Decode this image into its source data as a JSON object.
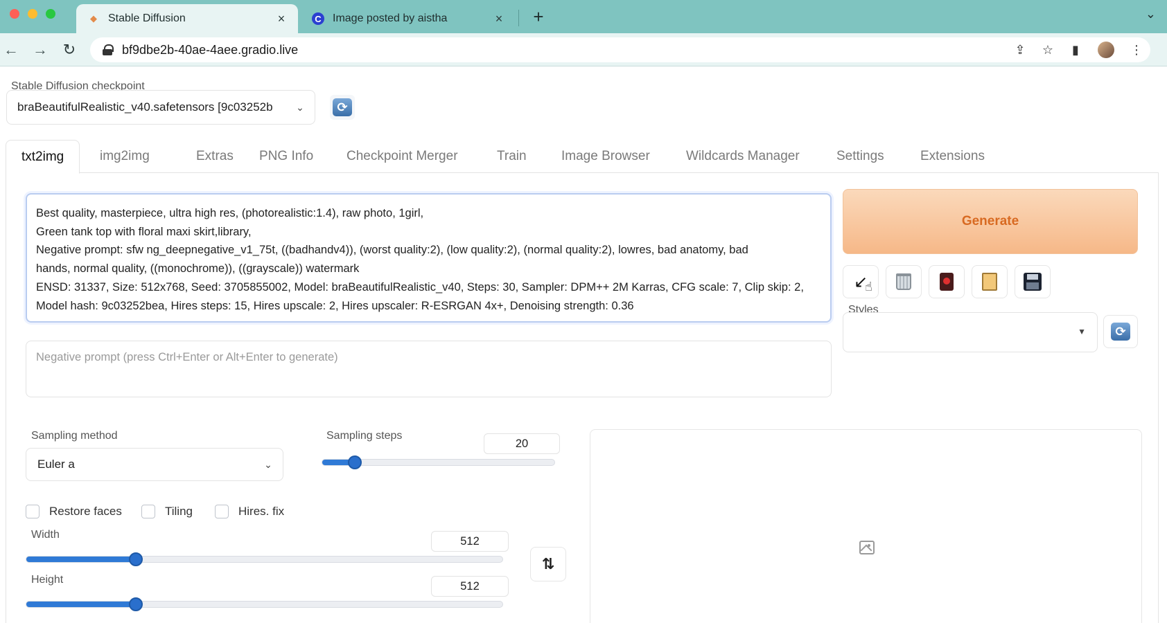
{
  "browser": {
    "tabs": [
      {
        "title": "Stable Diffusion",
        "active": true
      },
      {
        "title": "Image posted by aistha",
        "active": false
      }
    ],
    "url": "bf9dbe2b-40ae-4aee.gradio.live"
  },
  "checkpoint": {
    "label": "Stable Diffusion checkpoint",
    "value": "braBeautifulRealistic_v40.safetensors [9c03252b"
  },
  "tabs": [
    {
      "label": "txt2img",
      "active": true
    },
    {
      "label": "img2img"
    },
    {
      "label": "Extras"
    },
    {
      "label": "PNG Info"
    },
    {
      "label": "Checkpoint Merger"
    },
    {
      "label": "Train"
    },
    {
      "label": "Image Browser"
    },
    {
      "label": "Wildcards Manager"
    },
    {
      "label": "Settings"
    },
    {
      "label": "Extensions"
    }
  ],
  "prompt": {
    "lines": [
      "Best quality, masterpiece, ultra high res, (photorealistic:1.4), raw photo, 1girl,",
      "Green tank top with floral maxi skirt,library,",
      "Negative prompt: sfw ng_deepnegative_v1_75t, ((badhandv4)), (worst quality:2), (low quality:2), (normal quality:2), lowres, bad anatomy, bad",
      "hands, normal quality, ((monochrome)), ((grayscale)) watermark",
      "ENSD: 31337, Size: 512x768, Seed: 3705855002, Model: braBeautifulRealistic_v40, Steps: 30, Sampler: DPM++ 2M Karras, CFG scale: 7, Clip skip: 2,",
      "Model hash: 9c03252bea, Hires steps: 15, Hires upscale: 2, Hires upscaler: R-ESRGAN 4x+, Denoising strength: 0.36"
    ],
    "negative_placeholder": "Negative prompt (press Ctrl+Enter or Alt+Enter to generate)"
  },
  "generate_label": "Generate",
  "styles_label": "Styles",
  "sampling": {
    "method_label": "Sampling method",
    "method_value": "Euler a",
    "steps_label": "Sampling steps",
    "steps_value": "20",
    "steps_fraction": 0.14
  },
  "checkboxes": {
    "restore_faces": "Restore faces",
    "tiling": "Tiling",
    "hires_fix": "Hires. fix"
  },
  "width": {
    "label": "Width",
    "value": "512",
    "fraction": 0.23
  },
  "height": {
    "label": "Height",
    "value": "512",
    "fraction": 0.23
  }
}
